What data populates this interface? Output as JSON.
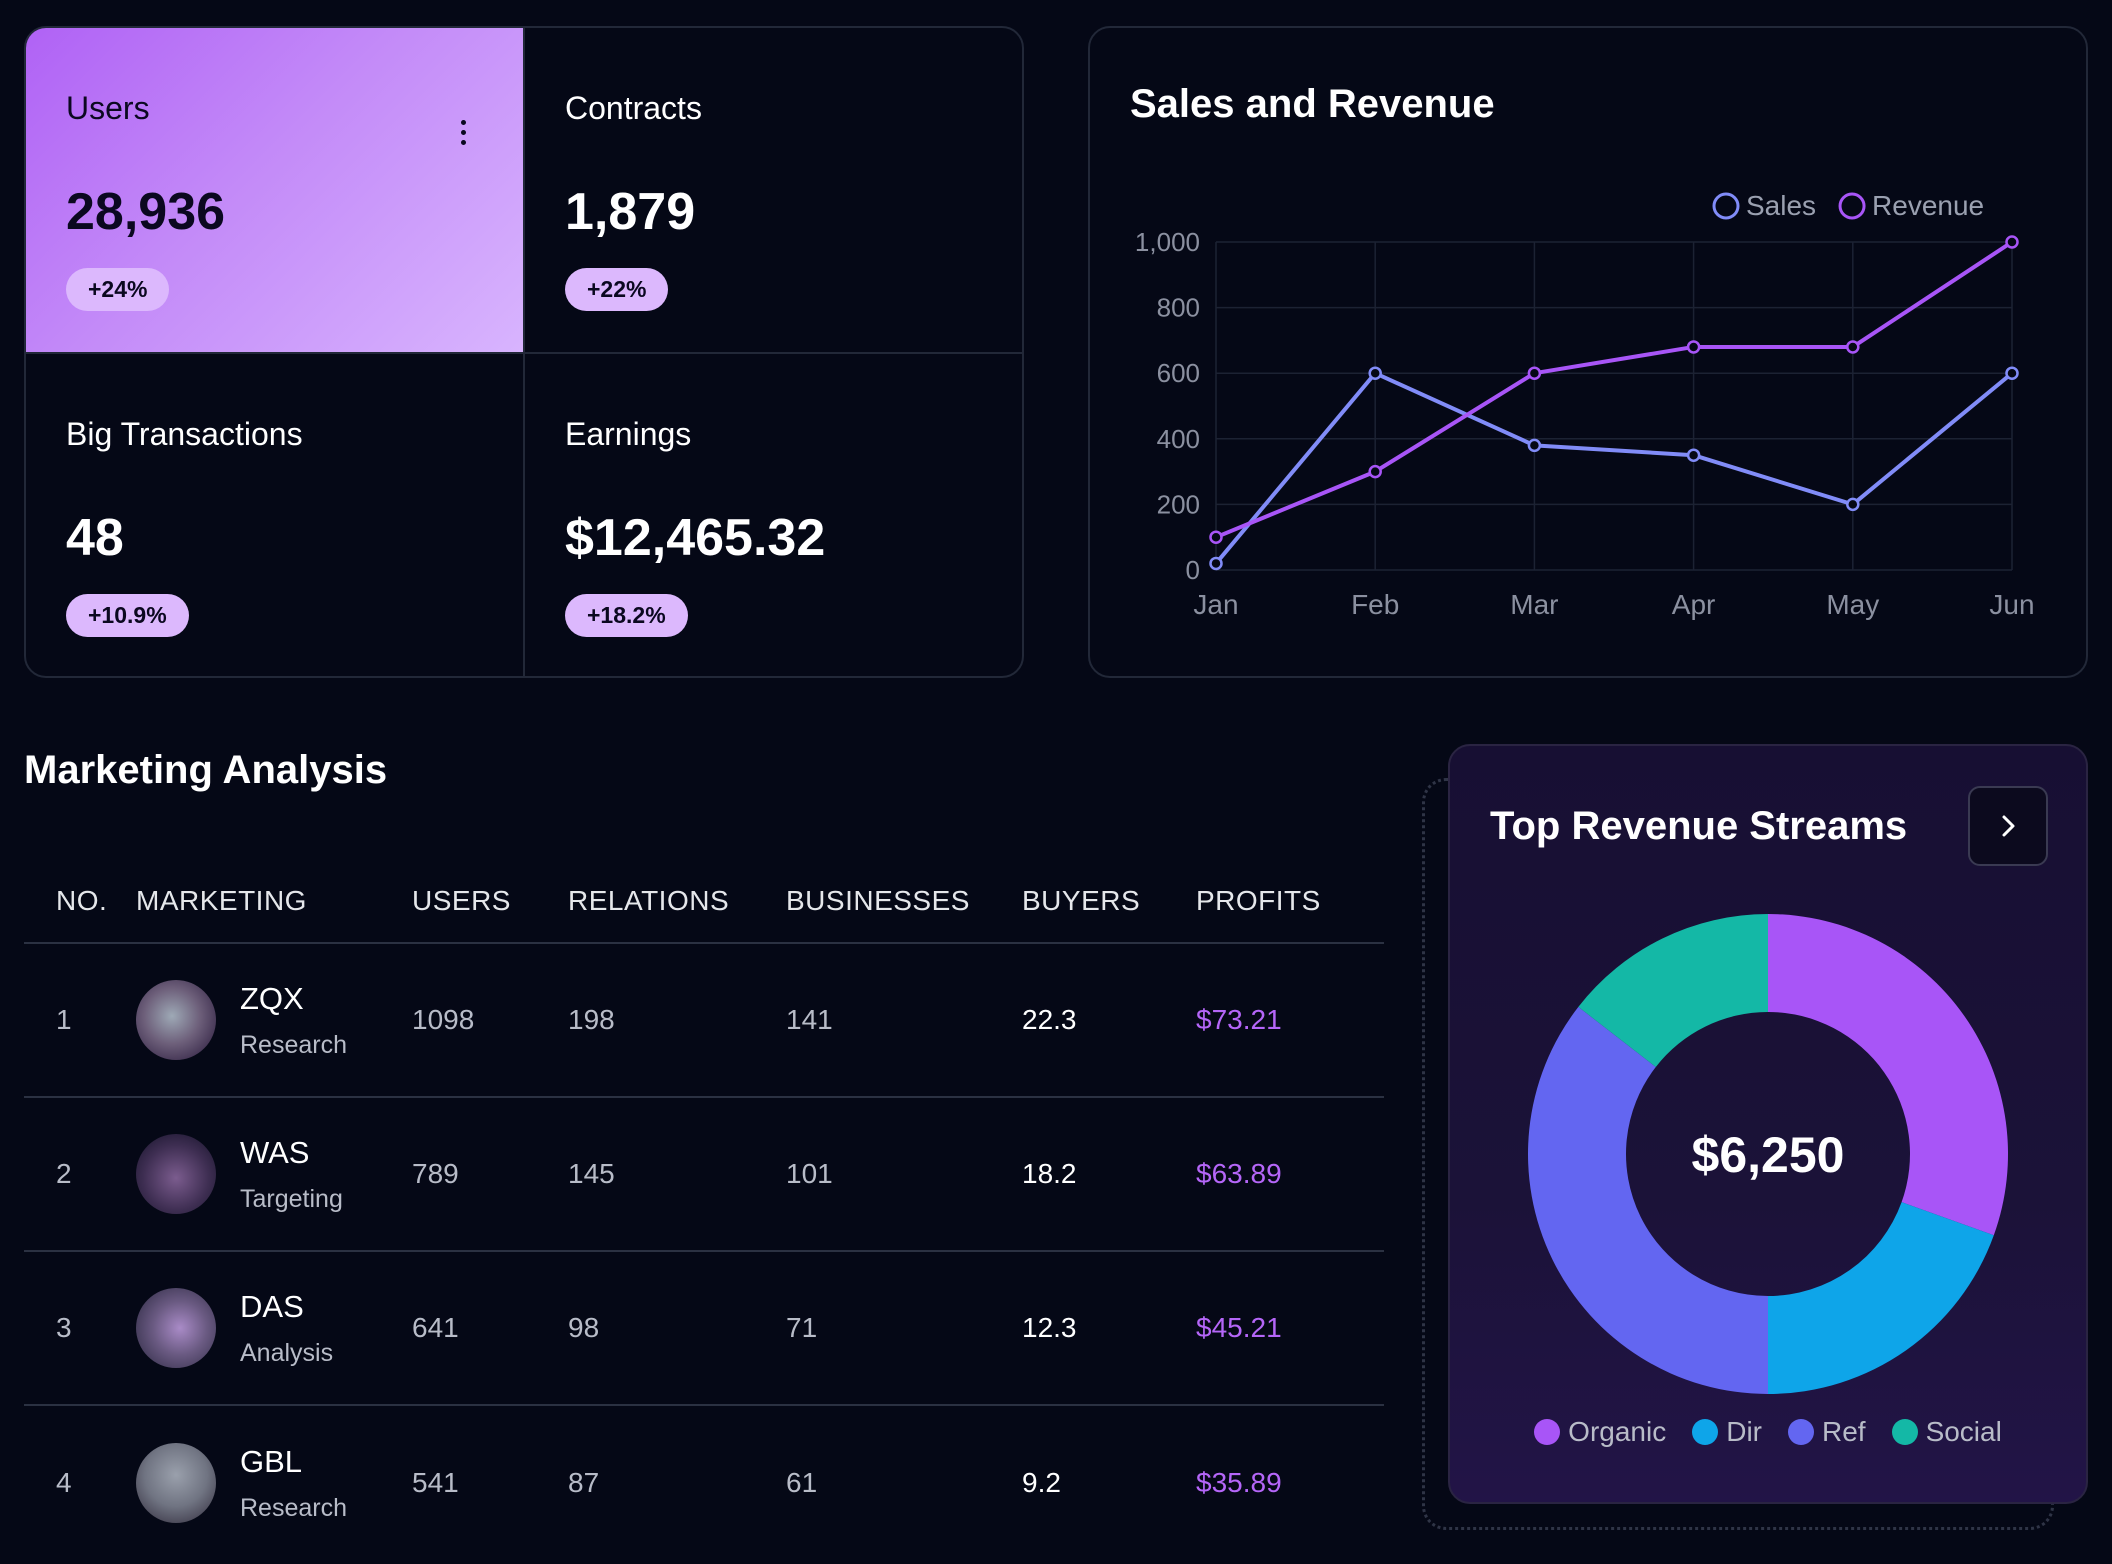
{
  "stats": [
    {
      "label": "Users",
      "value": "28,936",
      "change": "+24%"
    },
    {
      "label": "Contracts",
      "value": "1,879",
      "change": "+22%"
    },
    {
      "label": "Big Transactions",
      "value": "48",
      "change": "+10.9%"
    },
    {
      "label": "Earnings",
      "value": "$12,465.32",
      "change": "+18.2%"
    }
  ],
  "sales_chart": {
    "title": "Sales and Revenue"
  },
  "chart_data": {
    "type": "line",
    "title": "Sales and Revenue",
    "categories": [
      "Jan",
      "Feb",
      "Mar",
      "Apr",
      "May",
      "Jun"
    ],
    "ylim": [
      0,
      1000
    ],
    "yticks": [
      "0",
      "200",
      "400",
      "600",
      "800",
      "1,000"
    ],
    "grid": true,
    "legend": "top-right",
    "series": [
      {
        "name": "Sales",
        "color": "#818cf8",
        "values": [
          20,
          600,
          380,
          350,
          200,
          600
        ]
      },
      {
        "name": "Revenue",
        "color": "#a855f7",
        "values": [
          100,
          300,
          600,
          680,
          680,
          1000
        ]
      }
    ]
  },
  "marketing": {
    "title": "Marketing Analysis",
    "headers": [
      "NO.",
      "MARKETING",
      "USERS",
      "RELATIONS",
      "BUSINESSES",
      "BUYERS",
      "PROFITS"
    ],
    "rows": [
      {
        "no": "1",
        "name": "ZQX",
        "sub": "Research",
        "users": "1098",
        "relations": "198",
        "businesses": "141",
        "buyers": "22.3",
        "profits": "$73.21"
      },
      {
        "no": "2",
        "name": "WAS",
        "sub": "Targeting",
        "users": "789",
        "relations": "145",
        "businesses": "101",
        "buyers": "18.2",
        "profits": "$63.89"
      },
      {
        "no": "3",
        "name": "DAS",
        "sub": "Analysis",
        "users": "641",
        "relations": "98",
        "businesses": "71",
        "buyers": "12.3",
        "profits": "$45.21"
      },
      {
        "no": "4",
        "name": "GBL",
        "sub": "Research",
        "users": "541",
        "relations": "87",
        "businesses": "61",
        "buyers": "9.2",
        "profits": "$35.89"
      }
    ]
  },
  "revenue_streams": {
    "title": "Top Revenue Streams",
    "total": "$6,250",
    "button_icon": "chevron-right-icon",
    "slices": [
      {
        "name": "Organic",
        "color": "#a855f7",
        "value": 30.5
      },
      {
        "name": "Dir",
        "color": "#0ea5e9",
        "value": 19.5
      },
      {
        "name": "Ref",
        "color": "#6366f1",
        "value": 35.5
      },
      {
        "name": "Social",
        "color": "#14b8a6",
        "value": 14.5
      }
    ]
  }
}
